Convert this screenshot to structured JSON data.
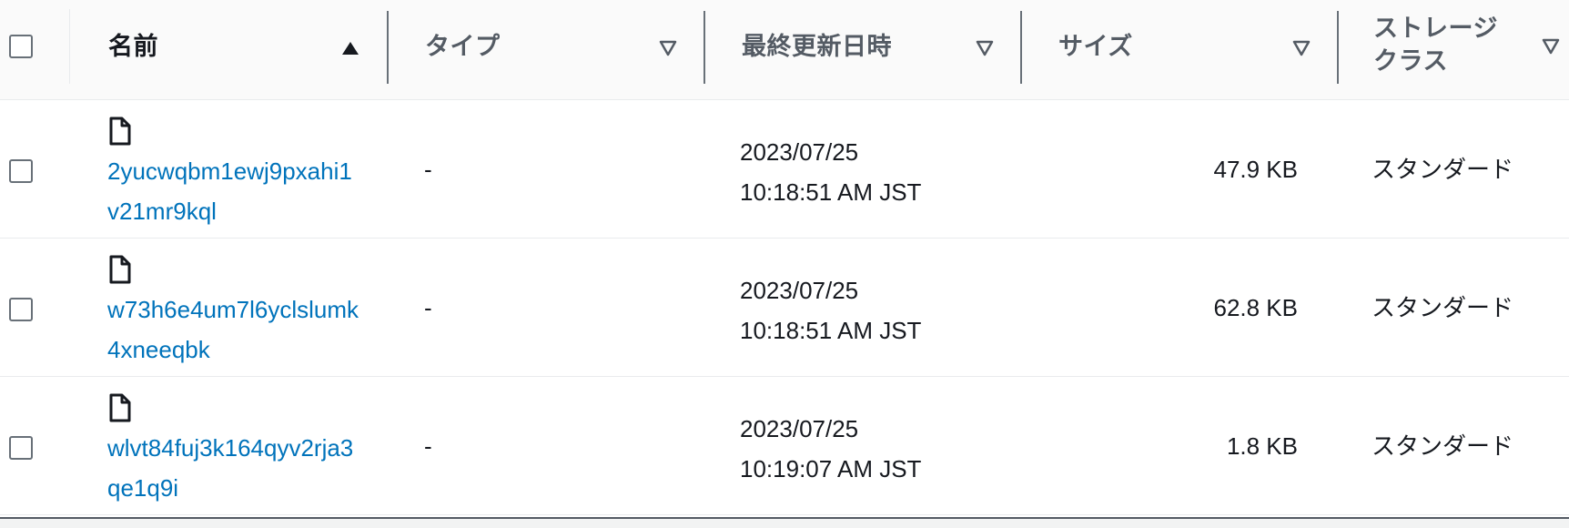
{
  "table": {
    "columns": [
      {
        "label": "名前",
        "sort": "ascending",
        "sort_icon": "caret-up-filled-icon"
      },
      {
        "label": "タイプ",
        "sort": "none",
        "sort_icon": "caret-down-outline-icon"
      },
      {
        "label": "最終更新日時",
        "sort": "none",
        "sort_icon": "caret-down-outline-icon"
      },
      {
        "label": "サイズ",
        "sort": "none",
        "sort_icon": "caret-down-outline-icon"
      },
      {
        "label": "ストレージクラス",
        "sort": "none",
        "sort_icon": "caret-down-outline-icon"
      }
    ],
    "rows": [
      {
        "icon": "file-icon",
        "name": "2yucwqbm1ewj9pxahi1v21mr9kql",
        "type": "-",
        "date": "2023/07/25",
        "time": "10:18:51 AM JST",
        "size": "47.9 KB",
        "storage_class": "スタンダード",
        "checked": false
      },
      {
        "icon": "file-icon",
        "name": "w73h6e4um7l6yclslumk4xneeqbk",
        "type": "-",
        "date": "2023/07/25",
        "time": "10:18:51 AM JST",
        "size": "62.8 KB",
        "storage_class": "スタンダード",
        "checked": false
      },
      {
        "icon": "file-icon",
        "name": "wlvt84fuj3k164qyv2rja3qe1q9i",
        "type": "-",
        "date": "2023/07/25",
        "time": "10:19:07 AM JST",
        "size": "1.8 KB",
        "storage_class": "スタンダード",
        "checked": false
      }
    ]
  },
  "colors": {
    "link": "#0073bb",
    "header_bg": "#fafafa",
    "text": "#16191f",
    "muted_text": "#545b64"
  }
}
